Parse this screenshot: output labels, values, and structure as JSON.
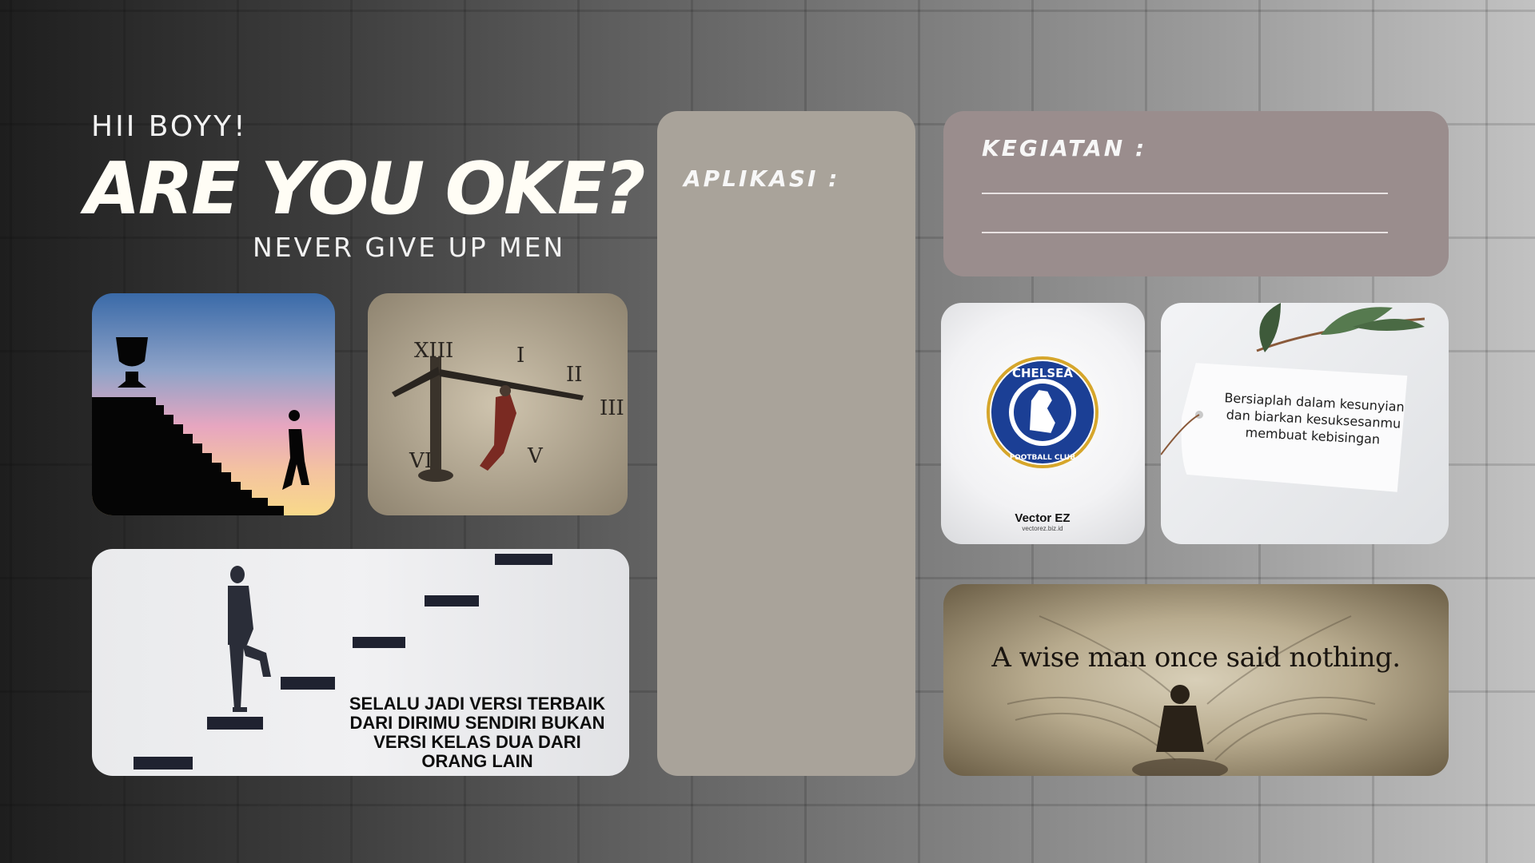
{
  "greeting": "HII BOYY!",
  "headline": "ARE YOU OKE?",
  "tagline": "NEVER GIVE UP MEN",
  "apps_panel": {
    "label": "APLIKASI :"
  },
  "activities_panel": {
    "label": "KEGIATAN :"
  },
  "images": {
    "clock_numerals": {
      "xiii": "XIII",
      "i": "I",
      "ii": "II",
      "iii": "III",
      "vi": "VI",
      "vii": "V"
    },
    "stairs_quote": [
      "SELALU JADI VERSI TERBAIK",
      "DARI DIRIMU SENDIRI BUKAN",
      "VERSI KELAS DUA DARI",
      "ORANG LAIN"
    ],
    "chelsea_logo": {
      "top": "CHELSEA",
      "bottom": "FOOTBALL CLUB",
      "credit": "Vector EZ",
      "credit_url": "vectorez.biz.id"
    },
    "tag_quote": [
      "Bersiaplah dalam kesunyian",
      "dan biarkan kesuksesanmu",
      "membuat kebisingan"
    ],
    "wise_quote": "A wise man once said nothing."
  },
  "colors": {
    "apps_panel": "#a9a39a",
    "activities_panel": "#9a8d8d",
    "headline": "#fffdf5"
  }
}
